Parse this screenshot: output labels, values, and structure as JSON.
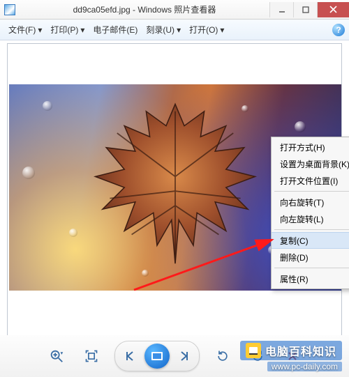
{
  "titlebar": {
    "title": "dd9ca05efd.jpg - Windows 照片查看器"
  },
  "menubar": {
    "file": "文件(F)",
    "print": "打印(P)",
    "email": "电子邮件(E)",
    "burn": "刻录(U)",
    "open": "打开(O)"
  },
  "context_menu": {
    "open_with": "打开方式(H)",
    "set_background": "设置为桌面背景(K)",
    "open_file_location": "打开文件位置(I)",
    "rotate_right": "向右旋转(T)",
    "rotate_left": "向左旋转(L)",
    "copy": "复制(C)",
    "delete": "删除(D)",
    "properties": "属性(R)"
  },
  "watermark": {
    "text": "电脑百科知识",
    "url": "www.pc-daily.com"
  },
  "icons": {
    "help": "?"
  }
}
